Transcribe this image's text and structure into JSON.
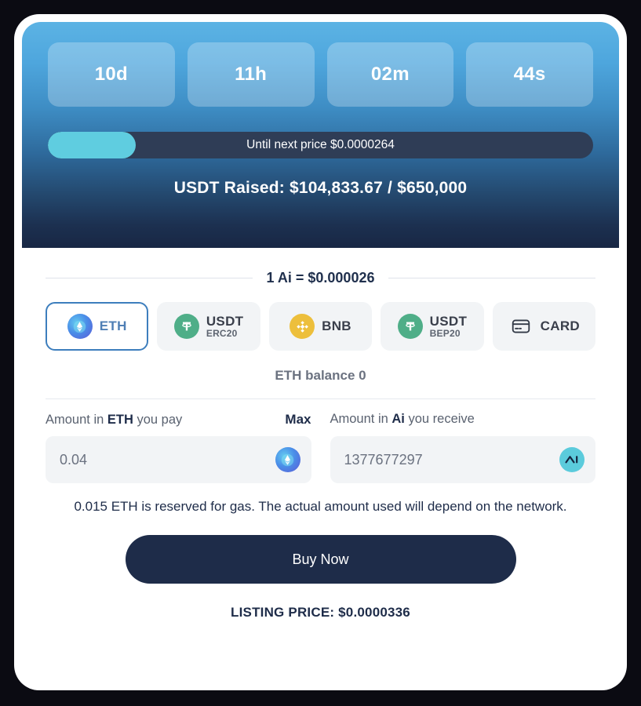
{
  "header": {
    "countdown": [
      {
        "value": "10d",
        "unit": "days"
      },
      {
        "value": "11h",
        "unit": "hours"
      },
      {
        "value": "02m",
        "unit": "minutes"
      },
      {
        "value": "44s",
        "unit": "seconds"
      }
    ],
    "progress": {
      "label": "Until next price $0.0000264",
      "percent": 16.1,
      "fill_color": "#5fcde0",
      "track_color": "#2f3d56"
    },
    "raised_text": "USDT Raised: $104,833.67 / $650,000",
    "gradient_top": "#5cb3e4",
    "gradient_bottom": "#182744"
  },
  "rate": {
    "text": "1 Ai = $0.000026"
  },
  "payment_methods": [
    {
      "main": "ETH",
      "sub": "",
      "icon": "eth-icon",
      "selected": true
    },
    {
      "main": "USDT",
      "sub": "ERC20",
      "icon": "usdt-icon",
      "selected": false
    },
    {
      "main": "BNB",
      "sub": "",
      "icon": "bnb-icon",
      "selected": false
    },
    {
      "main": "USDT",
      "sub": "BEP20",
      "icon": "usdt-icon",
      "selected": false
    },
    {
      "main": "CARD",
      "sub": "",
      "icon": "card-icon",
      "selected": false
    }
  ],
  "balance_text": "ETH balance 0",
  "pay_field": {
    "label_prefix": "Amount in ",
    "label_token": "ETH",
    "label_suffix": " you pay",
    "max_label": "Max",
    "value": "0.04",
    "placeholder": "0",
    "icon": "eth-icon"
  },
  "receive_field": {
    "label_prefix": "Amount in ",
    "label_token": "Ai",
    "label_suffix": " you receive",
    "value": "1377677297",
    "placeholder": "0",
    "icon": "ai-token-icon"
  },
  "gas_note": "0.015 ETH is reserved for gas. The actual amount used will depend on the network.",
  "buy_button_label": "Buy Now",
  "listing_price": "LISTING PRICE: $0.0000336",
  "colors": {
    "accent_cyan": "#5bcbdc",
    "navy": "#1e2c49",
    "usdt_green": "#4fae88",
    "bnb_gold": "#edbf3c",
    "selected_border": "#3d7ebd"
  }
}
